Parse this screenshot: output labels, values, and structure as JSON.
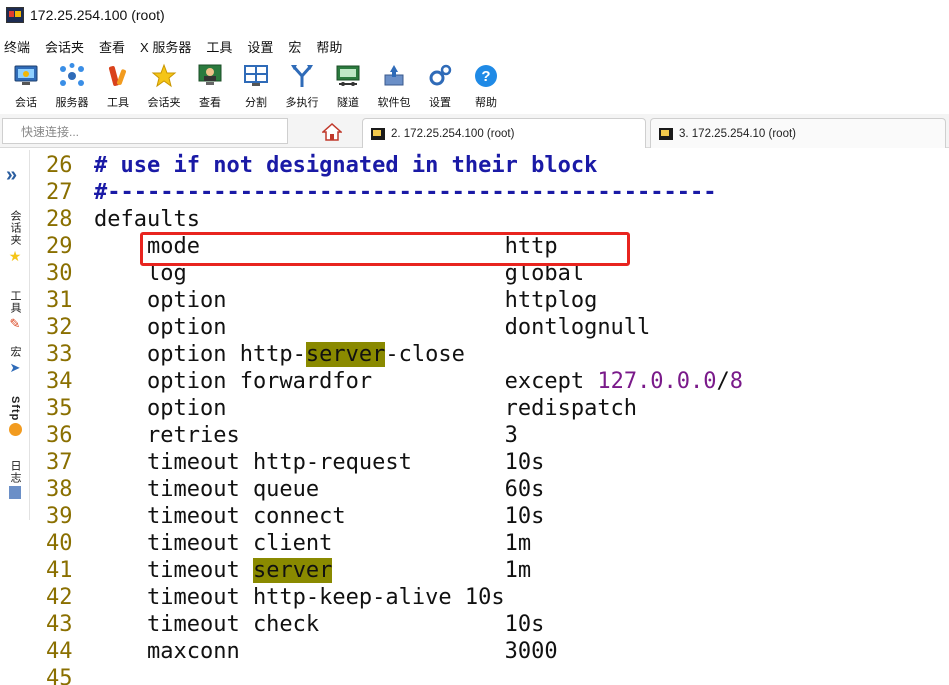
{
  "window": {
    "title": "172.25.254.100 (root)"
  },
  "menu": {
    "items": [
      "终端",
      "会话夹",
      "查看",
      "X 服务器",
      "工具",
      "设置",
      "宏",
      "帮助"
    ]
  },
  "toolbar": {
    "items": [
      {
        "label": "会话",
        "icon": "session-monitor-icon"
      },
      {
        "label": "服务器",
        "icon": "servers-icon"
      },
      {
        "label": "工具",
        "icon": "tools-icon"
      },
      {
        "label": "会话夹",
        "icon": "star-icon"
      },
      {
        "label": "查看",
        "icon": "view-icon"
      },
      {
        "label": "分割",
        "icon": "split-icon"
      },
      {
        "label": "多执行",
        "icon": "multi-exec-icon"
      },
      {
        "label": "隧道",
        "icon": "tunnel-icon"
      },
      {
        "label": "软件包",
        "icon": "packages-icon"
      },
      {
        "label": "设置",
        "icon": "settings-icon"
      },
      {
        "label": "帮助",
        "icon": "help-icon"
      }
    ]
  },
  "quick_connect": {
    "placeholder": "快速连接..."
  },
  "tabs": [
    {
      "label": "2. 172.25.254.100 (root)",
      "active": true
    },
    {
      "label": "3. 172.25.254.10 (root)",
      "active": false
    }
  ],
  "sidebar": {
    "items": [
      "会话夹",
      "工具",
      "宏",
      "Sftp",
      "日志"
    ]
  },
  "editor": {
    "lines": [
      {
        "n": "26",
        "parts": [
          {
            "t": "# use if not designated in their block",
            "c": "comment"
          }
        ]
      },
      {
        "n": "27",
        "parts": [
          {
            "t": "#----------------------------------------------",
            "c": "comment"
          }
        ]
      },
      {
        "n": "28",
        "parts": [
          {
            "t": "defaults",
            "c": "kw"
          }
        ]
      },
      {
        "n": "29",
        "parts": [
          {
            "t": "    mode                       http",
            "c": "kw"
          }
        ]
      },
      {
        "n": "30",
        "parts": [
          {
            "t": "    log                        global",
            "c": "kw"
          }
        ]
      },
      {
        "n": "31",
        "parts": [
          {
            "t": "    option                     httplog",
            "c": "kw"
          }
        ]
      },
      {
        "n": "32",
        "parts": [
          {
            "t": "    option                     dontlognull",
            "c": "kw"
          }
        ]
      },
      {
        "n": "33",
        "parts": [
          {
            "t": "    option http-",
            "c": "kw"
          },
          {
            "t": "server",
            "c": "hl"
          },
          {
            "t": "-close",
            "c": "kw"
          }
        ]
      },
      {
        "n": "34",
        "parts": [
          {
            "t": "    option forwardfor          except ",
            "c": "kw"
          },
          {
            "t": "127.0.0.0",
            "c": "num"
          },
          {
            "t": "/",
            "c": "kw"
          },
          {
            "t": "8",
            "c": "num"
          }
        ]
      },
      {
        "n": "35",
        "parts": [
          {
            "t": "    option                     redispatch",
            "c": "kw"
          }
        ]
      },
      {
        "n": "36",
        "parts": [
          {
            "t": "    retries                    ",
            "c": "kw"
          },
          {
            "t": "3",
            "c": "kw"
          }
        ]
      },
      {
        "n": "37",
        "parts": [
          {
            "t": "    timeout http-request       10s",
            "c": "kw"
          }
        ]
      },
      {
        "n": "38",
        "parts": [
          {
            "t": "    timeout queue              60s",
            "c": "kw"
          }
        ]
      },
      {
        "n": "39",
        "parts": [
          {
            "t": "    timeout connect            10s",
            "c": "kw"
          }
        ]
      },
      {
        "n": "40",
        "parts": [
          {
            "t": "    timeout client             1m",
            "c": "kw"
          }
        ]
      },
      {
        "n": "41",
        "parts": [
          {
            "t": "    timeout ",
            "c": "kw"
          },
          {
            "t": "server",
            "c": "hl"
          },
          {
            "t": "             1m",
            "c": "kw"
          }
        ]
      },
      {
        "n": "42",
        "parts": [
          {
            "t": "    timeout http-keep-alive 10s",
            "c": "kw"
          }
        ]
      },
      {
        "n": "43",
        "parts": [
          {
            "t": "    timeout check              10s",
            "c": "kw"
          }
        ]
      },
      {
        "n": "44",
        "parts": [
          {
            "t": "    maxconn                    3000",
            "c": "kw"
          }
        ]
      },
      {
        "n": "45",
        "parts": [
          {
            "t": "",
            "c": "kw"
          }
        ]
      }
    ],
    "highlight_box_line": "29"
  },
  "colors": {
    "comment": "#1a1aa6",
    "line_number": "#8a6f00",
    "highlight": "#8a8a00",
    "number": "#7a1a8a",
    "box": "#e8241f"
  }
}
